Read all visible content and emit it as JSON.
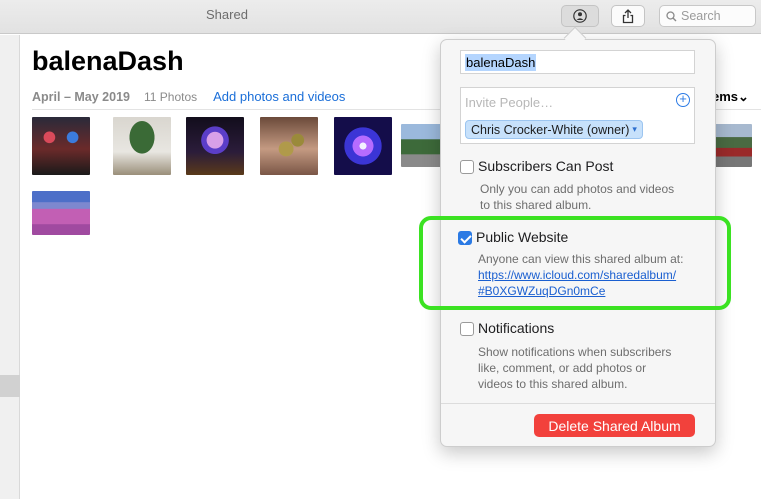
{
  "window": {
    "title": "Shared"
  },
  "toolbar": {
    "search_placeholder": "Search"
  },
  "album": {
    "title": "balenaDash",
    "date_range": "April – May 2019",
    "photo_count": "11 Photos",
    "add_link": "Add photos and videos",
    "items_label": "ems"
  },
  "popover": {
    "album_name_value": "balenaDash",
    "invite_placeholder": "Invite People…",
    "owner_chip": "Chris Crocker-White (owner)",
    "subscribers_label": "Subscribers Can Post",
    "subscribers_desc_1": "Only you can add photos and videos",
    "subscribers_desc_2": "to this shared album.",
    "public_label": "Public Website",
    "public_desc": "Anyone can view this shared album at:",
    "public_url_1": "https://www.icloud.com/sharedalbum/",
    "public_url_2": "#B0XGWZuqDGn0mCe",
    "notifications_label": "Notifications",
    "notifications_desc_1": "Show notifications when subscribers",
    "notifications_desc_2": "like, comment, or add photos or",
    "notifications_desc_3": "videos to this shared album.",
    "delete_button": "Delete Shared Album",
    "subscribers_checked": false,
    "public_checked": true,
    "notifications_checked": false
  },
  "colors": {
    "accent": "#2b7ae4",
    "danger": "#f2413c",
    "highlight": "#3be222"
  }
}
